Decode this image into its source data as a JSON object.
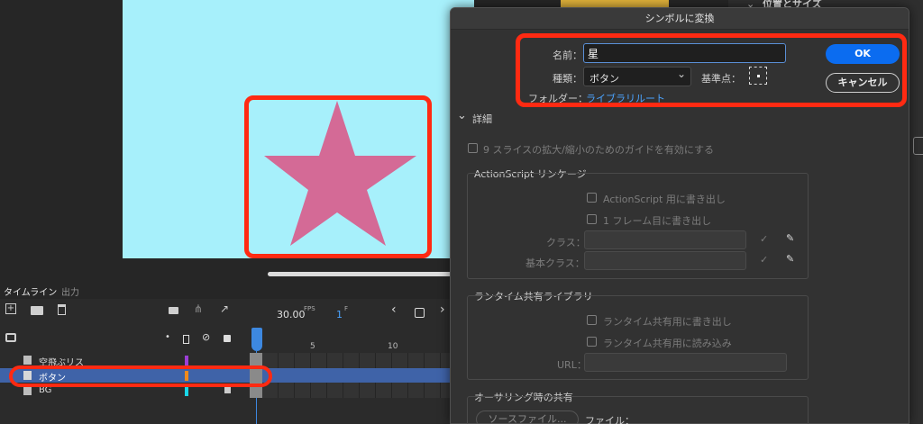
{
  "dialog": {
    "title": "シンボルに変換",
    "name_label": "名前：",
    "name_value": "星",
    "type_label": "種類：",
    "type_value": "ボタン",
    "registration_label": "基準点：",
    "folder_label": "フォルダー：",
    "folder_value": "ライブラリルート",
    "ok_label": "OK",
    "cancel_label": "キャンセル",
    "details_label": "詳細",
    "nine_slice_label": "9 スライスの拡大/縮小のためのガイドを有効にする",
    "as_linkage": {
      "title": "ActionScript リンケージ",
      "export_label": "ActionScript 用に書き出し",
      "first_frame_label": "1 フレーム目に書き出し",
      "class_label": "クラス：",
      "base_class_label": "基本クラス："
    },
    "runtime_shared": {
      "title": "ランタイム共有ライブラリ",
      "export_label": "ランタイム共有用に書き出し",
      "import_label": "ランタイム共有用に読み込み",
      "url_label": "URL："
    },
    "authoring": {
      "title": "オーサリング時の共有",
      "source_button": "ソースファイル...",
      "file_label": "ファイル："
    },
    "accent_color": "#0b6cf0",
    "link_color": "#4ba3ff"
  },
  "right_panel": {
    "title": "位置とサイズ"
  },
  "timeline": {
    "tabs": [
      "タイムライン",
      "出力"
    ],
    "fps": "30.00",
    "fps_unit": "FPS",
    "frame": "1",
    "frame_unit": "F",
    "frame_markers": [
      "5",
      "10"
    ],
    "layers": [
      {
        "name": "空飛ぶリス",
        "color": "#9b3fd6"
      },
      {
        "name": "ボタン",
        "color": "#f08a1c"
      },
      {
        "name": "BG",
        "color": "#19d6e8"
      }
    ]
  },
  "stage": {
    "background": "#a7f0fb",
    "star_color": "#d46a96"
  },
  "highlight_color": "#ff2a12"
}
